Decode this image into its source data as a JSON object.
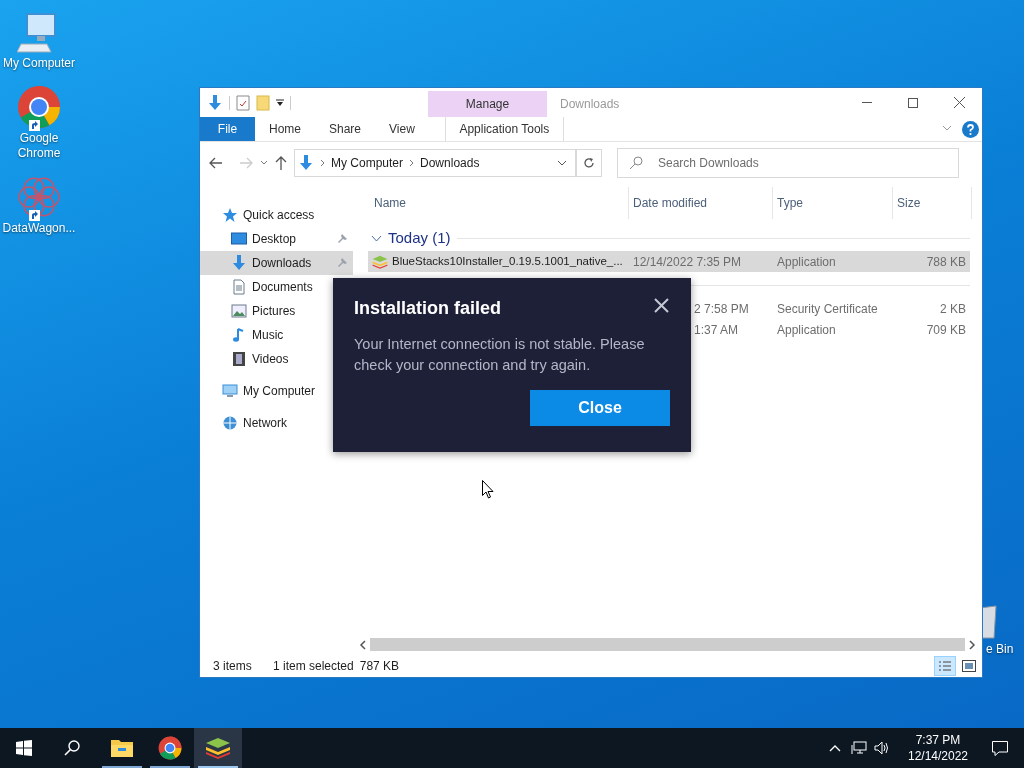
{
  "desktop": {
    "icons": [
      {
        "label": "My Computer",
        "kind": "computer",
        "shortcut": false
      },
      {
        "label": "Google Chrome",
        "kind": "chrome",
        "shortcut": true
      },
      {
        "label": "DataWagon...",
        "kind": "datawagon",
        "shortcut": true
      }
    ],
    "partial_icon": {
      "label": "e Bin",
      "kind": "recycle"
    }
  },
  "explorer": {
    "title": "Downloads",
    "context_tab": "Manage",
    "ribbon_tabs": [
      {
        "label": "File",
        "kind": "file"
      },
      {
        "label": "Home",
        "kind": "plain"
      },
      {
        "label": "Share",
        "kind": "plain"
      },
      {
        "label": "View",
        "kind": "plain"
      },
      {
        "label": "Application Tools",
        "kind": "context"
      }
    ],
    "address": [
      "My Computer",
      "Downloads"
    ],
    "search": {
      "placeholder": "Search Downloads"
    },
    "sidebar": [
      {
        "label": "Quick access",
        "kind": "star",
        "selected": false,
        "children": [
          {
            "label": "Desktop",
            "kind": "desktop",
            "selected": false,
            "pinned": true
          },
          {
            "label": "Downloads",
            "kind": "download",
            "selected": true,
            "pinned": true
          },
          {
            "label": "Documents",
            "kind": "document",
            "selected": false
          },
          {
            "label": "Pictures",
            "kind": "picture",
            "selected": false
          },
          {
            "label": "Music",
            "kind": "music",
            "selected": false
          },
          {
            "label": "Videos",
            "kind": "video",
            "selected": false
          }
        ]
      },
      {
        "label": "My Computer",
        "kind": "computer",
        "selected": false
      },
      {
        "label": "Network",
        "kind": "network",
        "selected": false
      }
    ],
    "columns": [
      "Name",
      "Date modified",
      "Type",
      "Size"
    ],
    "rows": [
      {
        "kind": "group",
        "label": "Today (1)",
        "expanded": true
      },
      {
        "kind": "file",
        "name": "BlueStacks10Installer_0.19.5.1001_native_...",
        "date": "12/14/2022 7:35 PM",
        "type": "Application",
        "size": "788 KB",
        "selected": true
      },
      {
        "kind": "group"
      },
      {
        "kind": "file",
        "date": "2 7:58 PM",
        "type": "Security Certificate",
        "size": "2 KB",
        "selected": false
      },
      {
        "kind": "file",
        "date": "1:37 AM",
        "type": "Application",
        "size": "709 KB",
        "selected": false
      }
    ],
    "status": {
      "items": "3 items",
      "selection": "1 item selected",
      "size": "787 KB"
    }
  },
  "dialog": {
    "title": "Installation failed",
    "message": "Your Internet connection is not stable. Please check your connection and try again.",
    "button": "Close"
  },
  "taskbar": {
    "apps": [
      {
        "kind": "explorer",
        "running": true,
        "active": false
      },
      {
        "kind": "chrome",
        "running": true,
        "active": false
      },
      {
        "kind": "bluestacks",
        "running": true,
        "active": true
      }
    ],
    "time": "7:37 PM",
    "date": "12/14/2022"
  }
}
